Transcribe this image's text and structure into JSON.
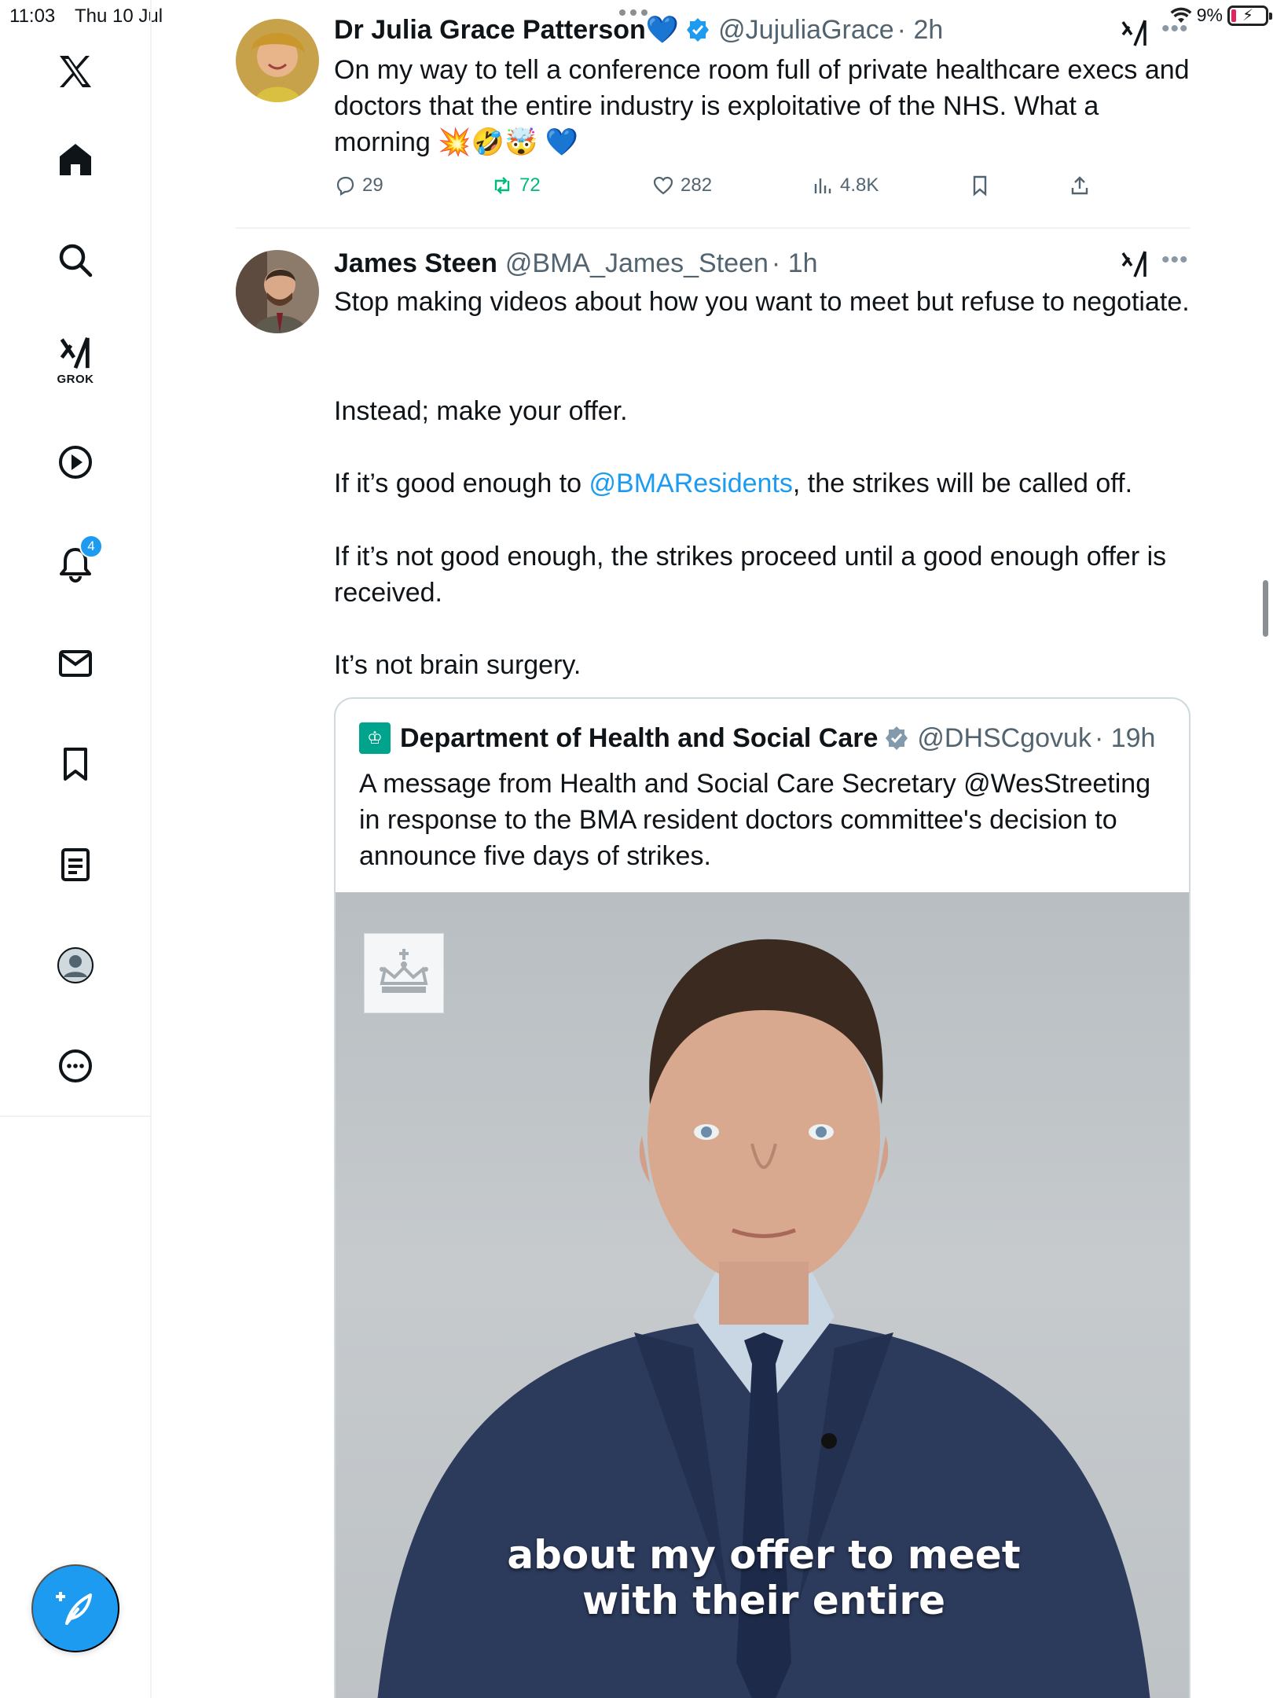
{
  "status_bar": {
    "time": "11:03",
    "date": "Thu 10 Jul",
    "battery": "9%",
    "battery_bolt": "⚡"
  },
  "sidebar": {
    "items": [
      {
        "name": "x-logo",
        "label": ""
      },
      {
        "name": "home",
        "label": ""
      },
      {
        "name": "search",
        "label": ""
      },
      {
        "name": "grok",
        "label": "GROK"
      },
      {
        "name": "video",
        "label": ""
      },
      {
        "name": "notifications",
        "label": "",
        "badge": "4"
      },
      {
        "name": "messages",
        "label": ""
      },
      {
        "name": "bookmarks",
        "label": ""
      },
      {
        "name": "lists",
        "label": ""
      },
      {
        "name": "profile",
        "label": ""
      },
      {
        "name": "more",
        "label": ""
      }
    ],
    "compose_icon": "feather-plus-icon"
  },
  "tweets": [
    {
      "display_name": "Dr Julia Grace Patterson",
      "name_emoji": "💙",
      "handle": "@JujuliaGrace",
      "time": "· 2h",
      "text": "On my way to tell a conference room full of private  healthcare execs and doctors that the entire industry is exploitative of the NHS. What a morning 💥🤣🤯 💙",
      "replies": "29",
      "retweets": "72",
      "likes": "282",
      "views": "4.8K"
    },
    {
      "display_name": "James Steen",
      "handle": "@BMA_James_Steen",
      "time": "· 1h",
      "text_p1": "Stop making videos about how you want to meet but refuse to negotiate.",
      "text_p2": "Instead; make your offer.",
      "text_p3_before": "If it’s good enough to ",
      "text_p3_mention": "@BMAResidents",
      "text_p3_after": ", the strikes will be called off.",
      "text_p4": "If it’s not good enough, the strikes proceed until a good enough offer is received.",
      "text_p5": "It’s not brain surgery.",
      "quote": {
        "display_name": "Department of Health and Social Care",
        "handle": "@DHSCgovuk",
        "time": "· 19h",
        "text": "A message from Health and Social Care Secretary @WesStreeting in response to the BMA resident doctors committee's decision to announce five days of strikes.",
        "video_caption_line1": "about my offer to meet",
        "video_caption_line2": "with their entire"
      }
    }
  ],
  "colors": {
    "accent": "#1d9bf0",
    "retweet_active": "#00ba7c",
    "secondary_text": "#536471",
    "dhsc_green": "#00a38b"
  }
}
